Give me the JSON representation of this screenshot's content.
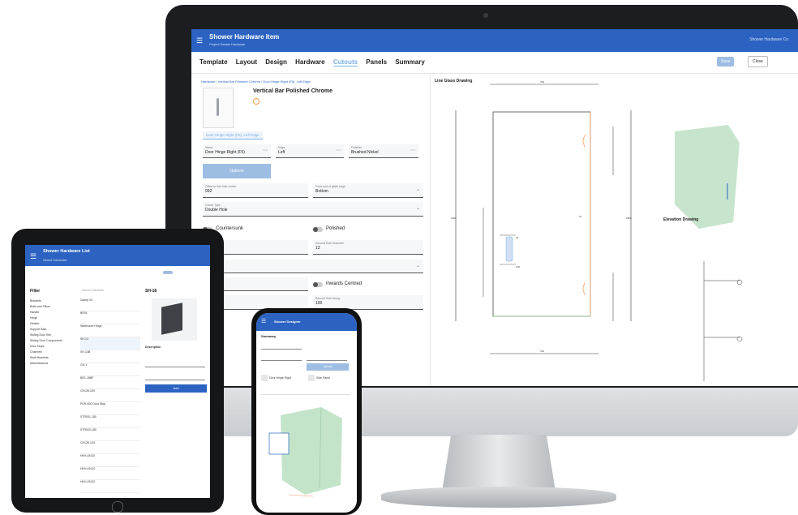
{
  "imac": {
    "app_title": "Shower Hardware Item",
    "app_subtitle": "Project Details Hardware",
    "user_label": "Shower Hardware Co",
    "tabs": [
      "Template",
      "Layout",
      "Design",
      "Hardware",
      "Cutouts",
      "Panels",
      "Summary"
    ],
    "active_tab": "Cutouts",
    "save_label": "Save",
    "close_label": "Close",
    "breadcrumb": "Hardware / Vertical Bar Polished Chrome / Door Hinge Right (F5), Left Edge",
    "item_title": "Vertical Bar Polished Chrome",
    "item_chip": "Door Hinge Right (F5), Left Edge",
    "fields": [
      {
        "label": "Name",
        "value": "Door Hinge Right (F5)"
      },
      {
        "label": "Edge",
        "value": "Left"
      },
      {
        "label": "Finishes",
        "value": "Brushed Nickel"
      }
    ],
    "options_label": "Options",
    "offset_field": {
      "label": "Offset to first hole centre",
      "value": "992"
    },
    "from_field": {
      "label": "From end of glass edge",
      "value": "Bottom"
    },
    "cutout_type": {
      "label": "Cutout Type",
      "value": "Double Hole"
    },
    "countersunk_label": "Countersunk",
    "polished_label": "Polished",
    "second_hole": {
      "label": "Second Hole Diameter",
      "value": "12"
    },
    "inwards_label": "Inwards Centred",
    "second_hole_2": {
      "label": "Second Hole Along",
      "value": "100"
    },
    "line_glass_title": "Line Glass Drawing",
    "elevation_title": "Elevation Drawing",
    "dims": {
      "top": "794",
      "bottom": "794",
      "left": "1900",
      "right": "1900",
      "mid": "37",
      "c1": "24",
      "c2": "100"
    }
  },
  "ipad": {
    "app_title": "Shower Hardware List",
    "app_subtitle": "Select Hardware",
    "filter_title": "Filter",
    "filters": [
      "Brackets",
      "Bolts and Fillers",
      "Handle",
      "Hinge",
      "Header",
      "Support Bars",
      "Sliding Door Kits",
      "Sliding Door Components",
      "Door Stops",
      "Channels",
      "Shelf Brackets",
      "Miscellaneous"
    ],
    "search_placeholder": "Search Hardware",
    "list_items": [
      "Clamp 03",
      "BR01",
      "Wallmount Hinge",
      "SH-13",
      "SH-13B",
      "GS-1",
      "BR1-18BF",
      "CH135-100",
      "POK-450 Door Stop",
      "STR001-180",
      "STR003-180",
      "CH135-100",
      "HKH-45110",
      "HKH-45120",
      "HKH-45120"
    ],
    "detail_title": "SH-18",
    "detail_desc": "Description",
    "add_label": "Add"
  },
  "iphone": {
    "app_title": "Shower Designer",
    "section": "Summary",
    "upload_label": "Upload",
    "items": [
      "Door Hinge Right",
      "Side Panel"
    ]
  },
  "colors": {
    "appbar": "#2c63c2",
    "accent": "#7bb0e8",
    "glass": "#b9dfc0",
    "dim_orange": "#f0a470"
  }
}
